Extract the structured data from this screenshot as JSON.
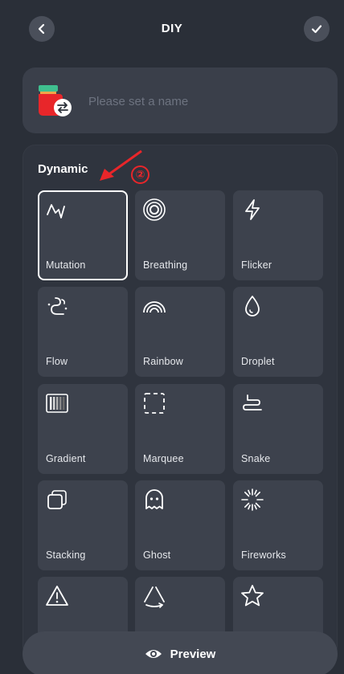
{
  "header": {
    "title": "DIY",
    "back_icon": "chevron-left-icon",
    "confirm_icon": "check-icon"
  },
  "name_field": {
    "placeholder": "Please set a name",
    "value": "",
    "icon": "lamp-swap-icon"
  },
  "dynamic_section": {
    "title": "Dynamic",
    "annotation_number": "②",
    "annotation_color": "#e8262a",
    "tiles": [
      {
        "label": "Mutation",
        "icon": "pulse-wave-icon",
        "selected": true
      },
      {
        "label": "Breathing",
        "icon": "concentric-rings-icon",
        "selected": false
      },
      {
        "label": "Flicker",
        "icon": "lightning-icon",
        "selected": false
      },
      {
        "label": "Flow",
        "icon": "flow-wind-icon",
        "selected": false
      },
      {
        "label": "Rainbow",
        "icon": "rainbow-icon",
        "selected": false
      },
      {
        "label": "Droplet",
        "icon": "droplet-icon",
        "selected": false
      },
      {
        "label": "Gradient",
        "icon": "gradient-bars-icon",
        "selected": false
      },
      {
        "label": "Marquee",
        "icon": "dashed-square-icon",
        "selected": false
      },
      {
        "label": "Snake",
        "icon": "snake-icon",
        "selected": false
      },
      {
        "label": "Stacking",
        "icon": "stacked-squares-icon",
        "selected": false
      },
      {
        "label": "Ghost",
        "icon": "ghost-icon",
        "selected": false
      },
      {
        "label": "Fireworks",
        "icon": "fireworks-icon",
        "selected": false
      },
      {
        "label": "",
        "icon": "warning-triangle-icon",
        "selected": false
      },
      {
        "label": "",
        "icon": "triangle-cycle-icon",
        "selected": false
      },
      {
        "label": "",
        "icon": "star-icon",
        "selected": false
      }
    ]
  },
  "footer": {
    "preview_label": "Preview",
    "preview_icon": "eye-icon"
  },
  "colors": {
    "background": "#2a2f38",
    "card": "#3a3f4a",
    "tile": "#3d424d",
    "accent_red": "#e8262a"
  }
}
